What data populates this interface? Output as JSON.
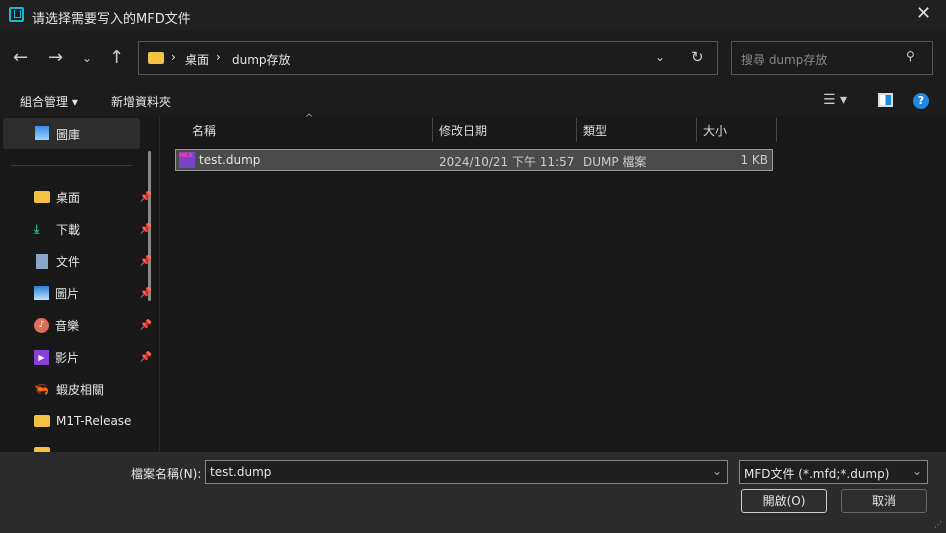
{
  "window": {
    "title": "请选择需要写入的MFD文件"
  },
  "nav": {
    "path": [
      "桌面",
      "dump存放"
    ],
    "search_placeholder": "搜尋 dump存放"
  },
  "toolbar": {
    "organize": "組合管理",
    "new_folder": "新增資料夾"
  },
  "sidebar": {
    "gallery": "圖庫",
    "items": [
      {
        "label": "桌面",
        "icon": "folder-icon",
        "pinned": true
      },
      {
        "label": "下載",
        "icon": "download-icon",
        "pinned": true
      },
      {
        "label": "文件",
        "icon": "document-icon",
        "pinned": true
      },
      {
        "label": "圖片",
        "icon": "pictures-icon",
        "pinned": true
      },
      {
        "label": "音樂",
        "icon": "music-icon",
        "pinned": true
      },
      {
        "label": "影片",
        "icon": "video-icon",
        "pinned": true
      },
      {
        "label": "蝦皮相關",
        "icon": "shrimp-icon",
        "pinned": false
      },
      {
        "label": "M1T-Release",
        "icon": "folder-icon",
        "pinned": false
      }
    ]
  },
  "columns": {
    "name": "名稱",
    "date": "修改日期",
    "type": "類型",
    "size": "大小"
  },
  "files": [
    {
      "name": "test.dump",
      "date": "2024/10/21 下午 11:57",
      "type": "DUMP 檔案",
      "size": "1 KB"
    }
  ],
  "bottom": {
    "filename_label": "檔案名稱(N):",
    "filename_value": "test.dump",
    "filter": "MFD文件 (*.mfd;*.dump)",
    "open": "開啟(O)",
    "cancel": "取消"
  }
}
